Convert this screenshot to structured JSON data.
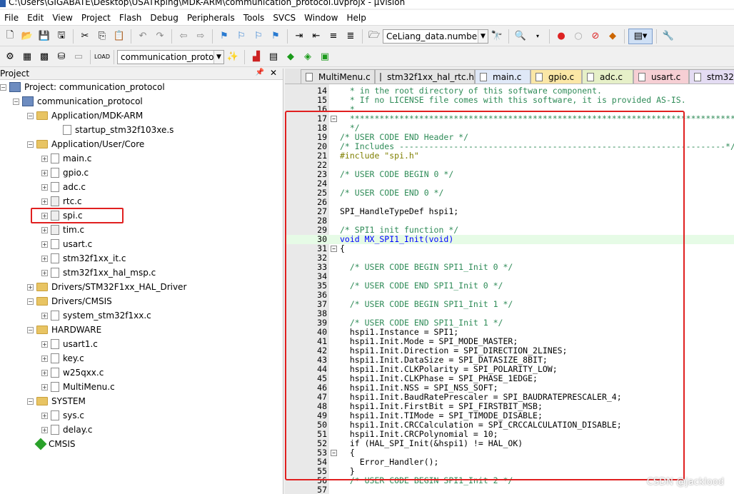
{
  "window": {
    "title": "C:\\Users\\GIGABATE\\Desktop\\USATRping\\MDK-ARM\\communication_protocol.uvprojx - µVision"
  },
  "menu": [
    "File",
    "Edit",
    "View",
    "Project",
    "Flash",
    "Debug",
    "Peripherals",
    "Tools",
    "SVCS",
    "Window",
    "Help"
  ],
  "toolbar1": {
    "find_combo": "CeLiang_data.number"
  },
  "toolbar2": {
    "target_combo": "communication_protoco"
  },
  "project_panel": {
    "title": "Project",
    "root": "Project: communication_protocol",
    "target": "communication_protocol",
    "groups": [
      {
        "name": "Application/MDK-ARM",
        "expanded": true,
        "files": [
          "startup_stm32f103xe.s"
        ]
      },
      {
        "name": "Application/User/Core",
        "expanded": true,
        "files": [
          "main.c",
          "gpio.c",
          "adc.c",
          "rtc.c",
          "spi.c",
          "tim.c",
          "usart.c",
          "stm32f1xx_it.c",
          "stm32f1xx_hal_msp.c"
        ]
      },
      {
        "name": "Drivers/STM32F1xx_HAL_Driver",
        "expanded": false,
        "files": []
      },
      {
        "name": "Drivers/CMSIS",
        "expanded": true,
        "files": [
          "system_stm32f1xx.c"
        ]
      },
      {
        "name": "HARDWARE",
        "expanded": true,
        "files": [
          "usart1.c",
          "key.c",
          "w25qxx.c",
          "MultiMenu.c"
        ]
      },
      {
        "name": "SYSTEM",
        "expanded": true,
        "files": [
          "sys.c",
          "delay.c"
        ]
      }
    ],
    "extra": "CMSIS"
  },
  "tabs": [
    {
      "label": "MultiMenu.c",
      "color": "#e4e4e4"
    },
    {
      "label": "stm32f1xx_hal_rtc.h",
      "color": "#e4e4e4"
    },
    {
      "label": "main.c",
      "color": "#dfe8f7"
    },
    {
      "label": "gpio.c",
      "color": "#fbe7a6"
    },
    {
      "label": "adc.c",
      "color": "#e6f0c8"
    },
    {
      "label": "usart.c",
      "color": "#f6cfd4"
    },
    {
      "label": "stm32",
      "color": "#e4dcf3"
    }
  ],
  "code": [
    {
      "n": "14",
      "t": "  * in the root directory of this software component.",
      "c": "cmt"
    },
    {
      "n": "15",
      "t": "  * If no LICENSE file comes with this software, it is provided AS-IS.",
      "c": "cmt"
    },
    {
      "n": "16",
      "t": "  *",
      "c": "cmt"
    },
    {
      "n": "17",
      "t": "  ******************************************************************************",
      "c": "cmt"
    },
    {
      "n": "18",
      "t": "  */",
      "c": "cmt"
    },
    {
      "n": "19",
      "t": "/* USER CODE END Header */",
      "c": "cmt"
    },
    {
      "n": "20",
      "t": "/* Includes ------------------------------------------------------------------*/",
      "c": "cmt"
    },
    {
      "n": "21",
      "t": "#include \"spi.h\"",
      "c": "pp"
    },
    {
      "n": "22",
      "t": "",
      "c": ""
    },
    {
      "n": "23",
      "t": "/* USER CODE BEGIN 0 */",
      "c": "cmt"
    },
    {
      "n": "24",
      "t": "",
      "c": ""
    },
    {
      "n": "25",
      "t": "/* USER CODE END 0 */",
      "c": "cmt"
    },
    {
      "n": "26",
      "t": "",
      "c": ""
    },
    {
      "n": "27",
      "t": "SPI_HandleTypeDef hspi1;",
      "c": ""
    },
    {
      "n": "28",
      "t": "",
      "c": ""
    },
    {
      "n": "29",
      "t": "/* SPI1 init function */",
      "c": "cmt"
    },
    {
      "n": "30",
      "t": "void MX_SPI1_Init(void)",
      "c": "kw"
    },
    {
      "n": "31",
      "t": "{",
      "c": ""
    },
    {
      "n": "32",
      "t": "",
      "c": ""
    },
    {
      "n": "33",
      "t": "  /* USER CODE BEGIN SPI1_Init 0 */",
      "c": "cmt"
    },
    {
      "n": "34",
      "t": "",
      "c": ""
    },
    {
      "n": "35",
      "t": "  /* USER CODE END SPI1_Init 0 */",
      "c": "cmt"
    },
    {
      "n": "36",
      "t": "",
      "c": ""
    },
    {
      "n": "37",
      "t": "  /* USER CODE BEGIN SPI1_Init 1 */",
      "c": "cmt"
    },
    {
      "n": "38",
      "t": "",
      "c": ""
    },
    {
      "n": "39",
      "t": "  /* USER CODE END SPI1_Init 1 */",
      "c": "cmt"
    },
    {
      "n": "40",
      "t": "  hspi1.Instance = SPI1;",
      "c": ""
    },
    {
      "n": "41",
      "t": "  hspi1.Init.Mode = SPI_MODE_MASTER;",
      "c": ""
    },
    {
      "n": "42",
      "t": "  hspi1.Init.Direction = SPI_DIRECTION_2LINES;",
      "c": ""
    },
    {
      "n": "43",
      "t": "  hspi1.Init.DataSize = SPI_DATASIZE_8BIT;",
      "c": ""
    },
    {
      "n": "44",
      "t": "  hspi1.Init.CLKPolarity = SPI_POLARITY_LOW;",
      "c": ""
    },
    {
      "n": "45",
      "t": "  hspi1.Init.CLKPhase = SPI_PHASE_1EDGE;",
      "c": ""
    },
    {
      "n": "46",
      "t": "  hspi1.Init.NSS = SPI_NSS_SOFT;",
      "c": ""
    },
    {
      "n": "47",
      "t": "  hspi1.Init.BaudRatePrescaler = SPI_BAUDRATEPRESCALER_4;",
      "c": ""
    },
    {
      "n": "48",
      "t": "  hspi1.Init.FirstBit = SPI_FIRSTBIT_MSB;",
      "c": ""
    },
    {
      "n": "49",
      "t": "  hspi1.Init.TIMode = SPI_TIMODE_DISABLE;",
      "c": ""
    },
    {
      "n": "50",
      "t": "  hspi1.Init.CRCCalculation = SPI_CRCCALCULATION_DISABLE;",
      "c": ""
    },
    {
      "n": "51",
      "t": "  hspi1.Init.CRCPolynomial = 10;",
      "c": ""
    },
    {
      "n": "52",
      "t": "  if (HAL_SPI_Init(&hspi1) != HAL_OK)",
      "c": ""
    },
    {
      "n": "53",
      "t": "  {",
      "c": ""
    },
    {
      "n": "54",
      "t": "    Error_Handler();",
      "c": ""
    },
    {
      "n": "55",
      "t": "  }",
      "c": ""
    },
    {
      "n": "56",
      "t": "  /* USER CODE BEGIN SPI1_Init 2 */",
      "c": "cmt"
    },
    {
      "n": "57",
      "t": "",
      "c": ""
    }
  ],
  "watermark": "CSDN @jacklood"
}
